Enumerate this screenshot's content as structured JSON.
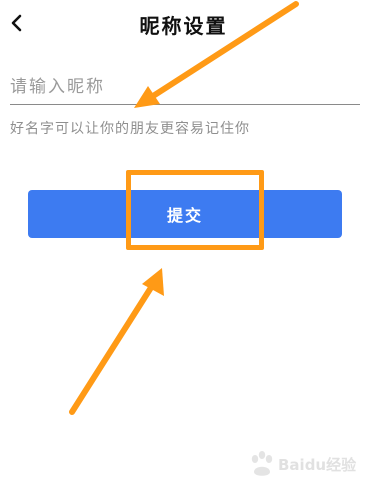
{
  "header": {
    "title": "昵称设置",
    "back_icon": "chevron-left-icon"
  },
  "nickname": {
    "placeholder": "请输入昵称",
    "value": "",
    "hint": "好名字可以让你的朋友更容易记住你"
  },
  "actions": {
    "submit_label": "提交"
  },
  "annotation": {
    "highlight_color": "#ff9a16",
    "arrow_color": "#ff9a16"
  },
  "watermark": {
    "text": "Baidu经验"
  },
  "colors": {
    "button_blue": "#3d7bf1",
    "title_text": "#111111",
    "hint_text": "#8f8f8f"
  }
}
